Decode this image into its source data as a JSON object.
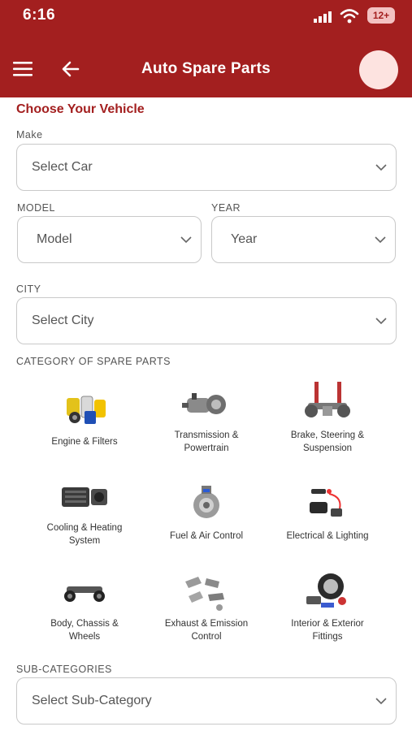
{
  "status_bar": {
    "time": "6:16",
    "battery": "12+"
  },
  "app_bar": {
    "title": "Auto Spare Parts"
  },
  "form": {
    "section_title": "Choose Your Vehicle",
    "make": {
      "label": "Make",
      "value": "Select Car"
    },
    "model": {
      "label": "MODEL",
      "value": "Model"
    },
    "year": {
      "label": "YEAR",
      "value": "Year"
    },
    "city": {
      "label": "CITY",
      "value": "Select City"
    }
  },
  "categories": {
    "title": "CATEGORY OF SPARE PARTS",
    "items": [
      {
        "label": "Engine & Filters"
      },
      {
        "label": "Transmission &\nPowertrain"
      },
      {
        "label": "Brake, Steering &\nSuspension"
      },
      {
        "label": "Cooling & Heating\nSystem"
      },
      {
        "label": "Fuel & Air Control"
      },
      {
        "label": "Electrical & Lighting"
      },
      {
        "label": "Body, Chassis &\nWheels"
      },
      {
        "label": "Exhaust & Emission\nControl"
      },
      {
        "label": "Interior & Exterior\nFittings"
      }
    ]
  },
  "sub_categories": {
    "label": "SUB-CATEGORIES",
    "value": "Select Sub-Category"
  },
  "colors": {
    "brand": "#a31f1f",
    "avatar": "#fde3e0"
  }
}
